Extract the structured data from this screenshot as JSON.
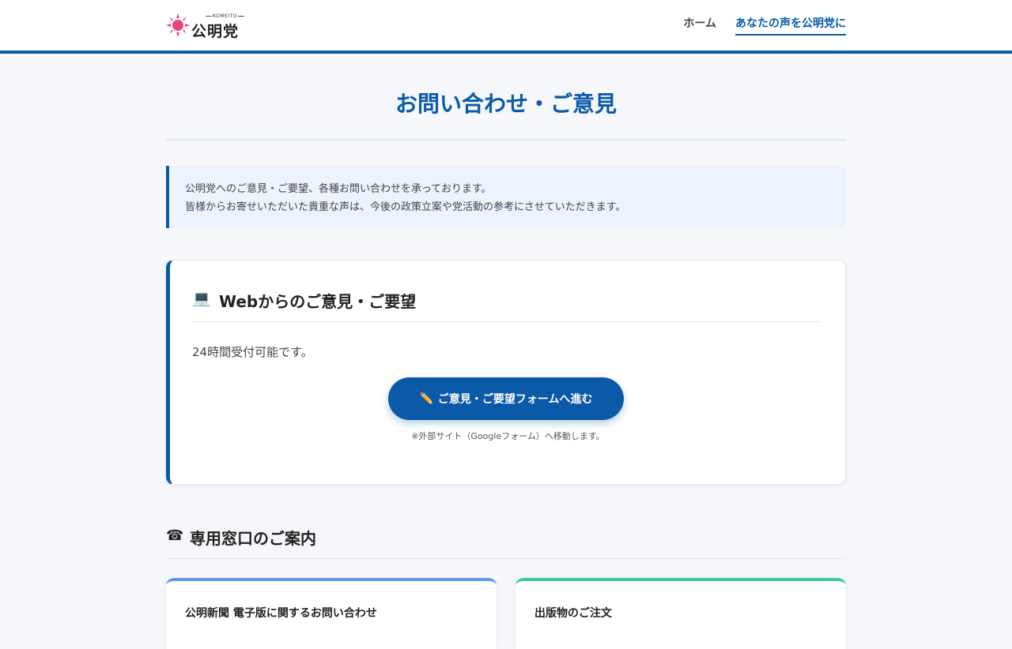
{
  "header": {
    "logo": {
      "sub_text": "KOMEITO",
      "name": "公明党",
      "icon": "sun-logo-icon"
    },
    "nav": [
      {
        "label": "ホーム",
        "active": false
      },
      {
        "label": "あなたの声を公明党に",
        "active": true
      }
    ]
  },
  "main": {
    "title": "お問い合わせ・ご意見",
    "intro_line1": "公明党へのご意見・ご要望、各種お問い合わせを承っております。",
    "intro_line2": "皆様からお寄せいただいた貴重な声は、今後の政策立案や党活動の参考にさせていただきます。",
    "web_card": {
      "icon": "💻",
      "title": "Webからのご意見・ご要望",
      "text": "24時間受付可能です。",
      "button_icon": "✏️",
      "button_label": "ご意見・ご要望フォームへ進む",
      "note": "※外部サイト（Googleフォーム）へ移動します。"
    },
    "contact_section": {
      "icon": "☎",
      "title": "専用窓口のご案内",
      "cards": [
        {
          "title": "公明新聞 電子版に関するお問い合わせ",
          "accent": "#5b9be6"
        },
        {
          "title": "出版物のご注文",
          "accent": "#3ecb8f"
        }
      ]
    }
  },
  "colors": {
    "primary": "#0a5aa8",
    "background": "#f5f7fa",
    "intro_bg": "#ecf3fc"
  }
}
